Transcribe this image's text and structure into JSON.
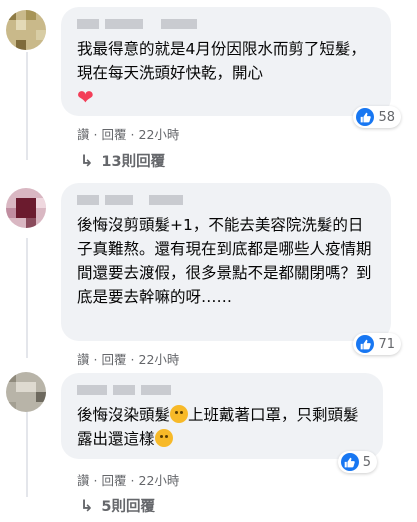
{
  "comments": [
    {
      "text": "我最得意的就是4月份因限水而剪了短髮，現在每天洗頭好快乾，開心",
      "heart": "❤",
      "actions": {
        "like": "讚",
        "reply": "回覆",
        "time": "22小時"
      },
      "reaction_count": "58",
      "replies_label": "13則回覆"
    },
    {
      "text": "後悔沒剪頭髮+1，不能去美容院洗髮的日子真難熬。還有現在到底都是哪些人疫情期間還要去渡假，很多景點不是都關閉嗎？到底是要去幹嘛的呀……",
      "actions": {
        "like": "讚",
        "reply": "回覆",
        "time": "22小時"
      },
      "reaction_count": "71"
    },
    {
      "text_a": "後悔沒染頭髮",
      "text_b": "上班戴著口罩，只剩頭髮露出還這樣",
      "actions": {
        "like": "讚",
        "reply": "回覆",
        "time": "22小時"
      },
      "reaction_count": "5",
      "replies_label": "5則回覆"
    }
  ],
  "icons": {
    "like": "thumbs-up-icon",
    "reply_arrow": "reply-arrow-icon",
    "emoji": "crying-face-icon"
  },
  "colors": {
    "like_blue": "#1877f2",
    "bubble": "#f0f2f5",
    "meta": "#65676b"
  }
}
